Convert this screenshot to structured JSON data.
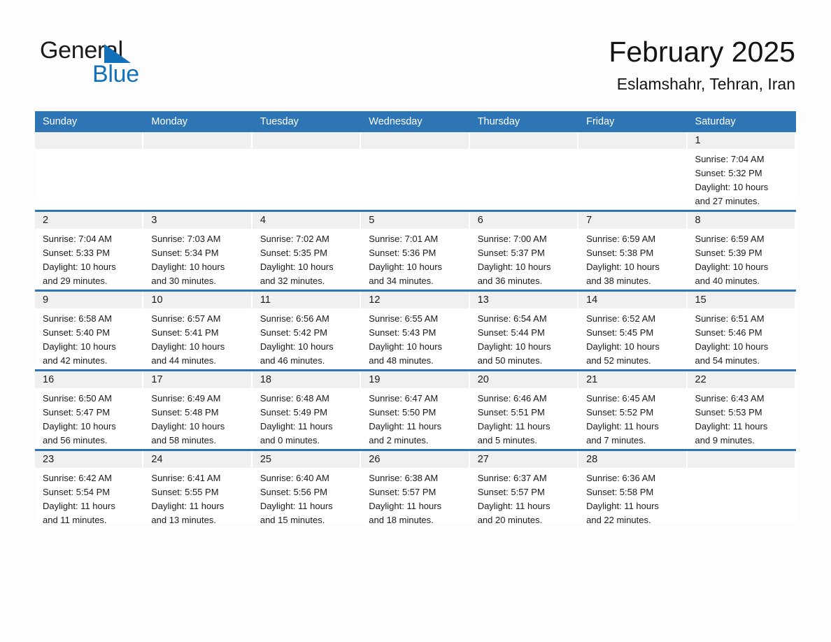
{
  "brand": {
    "name_part1": "General",
    "name_part2": "Blue",
    "accent_color": "#1271b8"
  },
  "header": {
    "title": "February 2025",
    "subtitle": "Eslamshahr, Tehran, Iran"
  },
  "theme": {
    "header_blue": "#2e75b6",
    "band_gray": "#f0f0f0",
    "page_bg": "#fdfdfd"
  },
  "weekday_headers": [
    "Sunday",
    "Monday",
    "Tuesday",
    "Wednesday",
    "Thursday",
    "Friday",
    "Saturday"
  ],
  "weeks": [
    [
      {
        "day": "",
        "sunrise": "",
        "sunset": "",
        "daylight1": "",
        "daylight2": ""
      },
      {
        "day": "",
        "sunrise": "",
        "sunset": "",
        "daylight1": "",
        "daylight2": ""
      },
      {
        "day": "",
        "sunrise": "",
        "sunset": "",
        "daylight1": "",
        "daylight2": ""
      },
      {
        "day": "",
        "sunrise": "",
        "sunset": "",
        "daylight1": "",
        "daylight2": ""
      },
      {
        "day": "",
        "sunrise": "",
        "sunset": "",
        "daylight1": "",
        "daylight2": ""
      },
      {
        "day": "",
        "sunrise": "",
        "sunset": "",
        "daylight1": "",
        "daylight2": ""
      },
      {
        "day": "1",
        "sunrise": "Sunrise: 7:04 AM",
        "sunset": "Sunset: 5:32 PM",
        "daylight1": "Daylight: 10 hours",
        "daylight2": "and 27 minutes."
      }
    ],
    [
      {
        "day": "2",
        "sunrise": "Sunrise: 7:04 AM",
        "sunset": "Sunset: 5:33 PM",
        "daylight1": "Daylight: 10 hours",
        "daylight2": "and 29 minutes."
      },
      {
        "day": "3",
        "sunrise": "Sunrise: 7:03 AM",
        "sunset": "Sunset: 5:34 PM",
        "daylight1": "Daylight: 10 hours",
        "daylight2": "and 30 minutes."
      },
      {
        "day": "4",
        "sunrise": "Sunrise: 7:02 AM",
        "sunset": "Sunset: 5:35 PM",
        "daylight1": "Daylight: 10 hours",
        "daylight2": "and 32 minutes."
      },
      {
        "day": "5",
        "sunrise": "Sunrise: 7:01 AM",
        "sunset": "Sunset: 5:36 PM",
        "daylight1": "Daylight: 10 hours",
        "daylight2": "and 34 minutes."
      },
      {
        "day": "6",
        "sunrise": "Sunrise: 7:00 AM",
        "sunset": "Sunset: 5:37 PM",
        "daylight1": "Daylight: 10 hours",
        "daylight2": "and 36 minutes."
      },
      {
        "day": "7",
        "sunrise": "Sunrise: 6:59 AM",
        "sunset": "Sunset: 5:38 PM",
        "daylight1": "Daylight: 10 hours",
        "daylight2": "and 38 minutes."
      },
      {
        "day": "8",
        "sunrise": "Sunrise: 6:59 AM",
        "sunset": "Sunset: 5:39 PM",
        "daylight1": "Daylight: 10 hours",
        "daylight2": "and 40 minutes."
      }
    ],
    [
      {
        "day": "9",
        "sunrise": "Sunrise: 6:58 AM",
        "sunset": "Sunset: 5:40 PM",
        "daylight1": "Daylight: 10 hours",
        "daylight2": "and 42 minutes."
      },
      {
        "day": "10",
        "sunrise": "Sunrise: 6:57 AM",
        "sunset": "Sunset: 5:41 PM",
        "daylight1": "Daylight: 10 hours",
        "daylight2": "and 44 minutes."
      },
      {
        "day": "11",
        "sunrise": "Sunrise: 6:56 AM",
        "sunset": "Sunset: 5:42 PM",
        "daylight1": "Daylight: 10 hours",
        "daylight2": "and 46 minutes."
      },
      {
        "day": "12",
        "sunrise": "Sunrise: 6:55 AM",
        "sunset": "Sunset: 5:43 PM",
        "daylight1": "Daylight: 10 hours",
        "daylight2": "and 48 minutes."
      },
      {
        "day": "13",
        "sunrise": "Sunrise: 6:54 AM",
        "sunset": "Sunset: 5:44 PM",
        "daylight1": "Daylight: 10 hours",
        "daylight2": "and 50 minutes."
      },
      {
        "day": "14",
        "sunrise": "Sunrise: 6:52 AM",
        "sunset": "Sunset: 5:45 PM",
        "daylight1": "Daylight: 10 hours",
        "daylight2": "and 52 minutes."
      },
      {
        "day": "15",
        "sunrise": "Sunrise: 6:51 AM",
        "sunset": "Sunset: 5:46 PM",
        "daylight1": "Daylight: 10 hours",
        "daylight2": "and 54 minutes."
      }
    ],
    [
      {
        "day": "16",
        "sunrise": "Sunrise: 6:50 AM",
        "sunset": "Sunset: 5:47 PM",
        "daylight1": "Daylight: 10 hours",
        "daylight2": "and 56 minutes."
      },
      {
        "day": "17",
        "sunrise": "Sunrise: 6:49 AM",
        "sunset": "Sunset: 5:48 PM",
        "daylight1": "Daylight: 10 hours",
        "daylight2": "and 58 minutes."
      },
      {
        "day": "18",
        "sunrise": "Sunrise: 6:48 AM",
        "sunset": "Sunset: 5:49 PM",
        "daylight1": "Daylight: 11 hours",
        "daylight2": "and 0 minutes."
      },
      {
        "day": "19",
        "sunrise": "Sunrise: 6:47 AM",
        "sunset": "Sunset: 5:50 PM",
        "daylight1": "Daylight: 11 hours",
        "daylight2": "and 2 minutes."
      },
      {
        "day": "20",
        "sunrise": "Sunrise: 6:46 AM",
        "sunset": "Sunset: 5:51 PM",
        "daylight1": "Daylight: 11 hours",
        "daylight2": "and 5 minutes."
      },
      {
        "day": "21",
        "sunrise": "Sunrise: 6:45 AM",
        "sunset": "Sunset: 5:52 PM",
        "daylight1": "Daylight: 11 hours",
        "daylight2": "and 7 minutes."
      },
      {
        "day": "22",
        "sunrise": "Sunrise: 6:43 AM",
        "sunset": "Sunset: 5:53 PM",
        "daylight1": "Daylight: 11 hours",
        "daylight2": "and 9 minutes."
      }
    ],
    [
      {
        "day": "23",
        "sunrise": "Sunrise: 6:42 AM",
        "sunset": "Sunset: 5:54 PM",
        "daylight1": "Daylight: 11 hours",
        "daylight2": "and 11 minutes."
      },
      {
        "day": "24",
        "sunrise": "Sunrise: 6:41 AM",
        "sunset": "Sunset: 5:55 PM",
        "daylight1": "Daylight: 11 hours",
        "daylight2": "and 13 minutes."
      },
      {
        "day": "25",
        "sunrise": "Sunrise: 6:40 AM",
        "sunset": "Sunset: 5:56 PM",
        "daylight1": "Daylight: 11 hours",
        "daylight2": "and 15 minutes."
      },
      {
        "day": "26",
        "sunrise": "Sunrise: 6:38 AM",
        "sunset": "Sunset: 5:57 PM",
        "daylight1": "Daylight: 11 hours",
        "daylight2": "and 18 minutes."
      },
      {
        "day": "27",
        "sunrise": "Sunrise: 6:37 AM",
        "sunset": "Sunset: 5:57 PM",
        "daylight1": "Daylight: 11 hours",
        "daylight2": "and 20 minutes."
      },
      {
        "day": "28",
        "sunrise": "Sunrise: 6:36 AM",
        "sunset": "Sunset: 5:58 PM",
        "daylight1": "Daylight: 11 hours",
        "daylight2": "and 22 minutes."
      },
      {
        "day": "",
        "sunrise": "",
        "sunset": "",
        "daylight1": "",
        "daylight2": ""
      }
    ]
  ]
}
